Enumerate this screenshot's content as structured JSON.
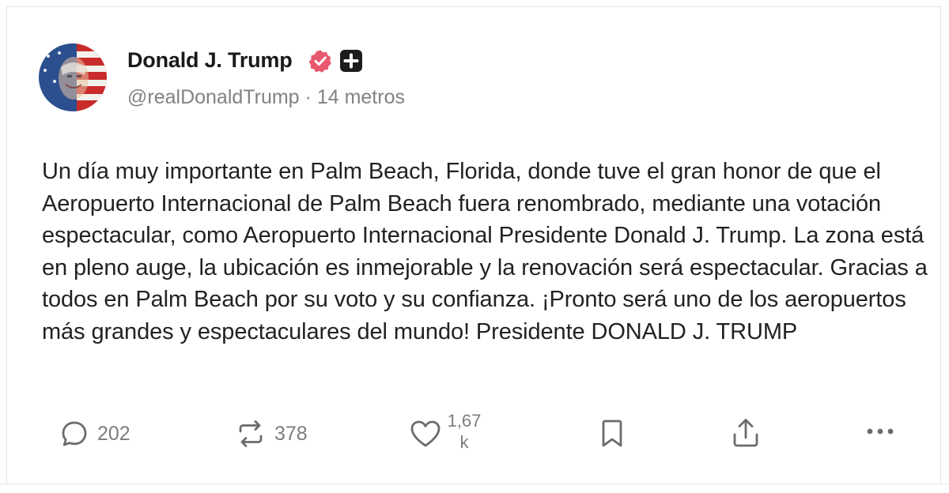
{
  "post": {
    "author": {
      "name": "Donald J. Trump",
      "handle": "@realDonaldTrump",
      "separator": " · ",
      "time": "14 metros",
      "avatar": "avatar-flag-portrait",
      "verified_icon": "verified-badge-icon",
      "plus_icon": "truth-plus-icon"
    },
    "body": "Un día muy importante en Palm Beach, Florida, donde tuve el gran honor de que el Aeropuerto Internacional de Palm Beach fuera renombrado, mediante una votación espectacular, como Aeropuerto Internacional Presidente Donald J. Trump. La zona está en pleno auge, la ubicación es inmejorable y la renovación será espectacular. Gracias a todos en Palm Beach por su voto y su confianza. ¡Pronto será uno de los aeropuertos más grandes y espectaculares del mundo! Presidente DONALD J. TRUMP",
    "actions": {
      "reply": {
        "icon": "reply-icon",
        "count": "202"
      },
      "retruth": {
        "icon": "retruth-icon",
        "count": "378"
      },
      "like": {
        "icon": "heart-icon",
        "count_line1": "1,67",
        "count_line2": "k"
      },
      "bookmark": {
        "icon": "bookmark-icon"
      },
      "share": {
        "icon": "share-icon"
      },
      "more": {
        "icon": "more-icon"
      }
    }
  },
  "colors": {
    "verified": "#e8596f",
    "text": "#222222",
    "muted": "#7d7d7d",
    "icon": "#6b6b6b"
  }
}
